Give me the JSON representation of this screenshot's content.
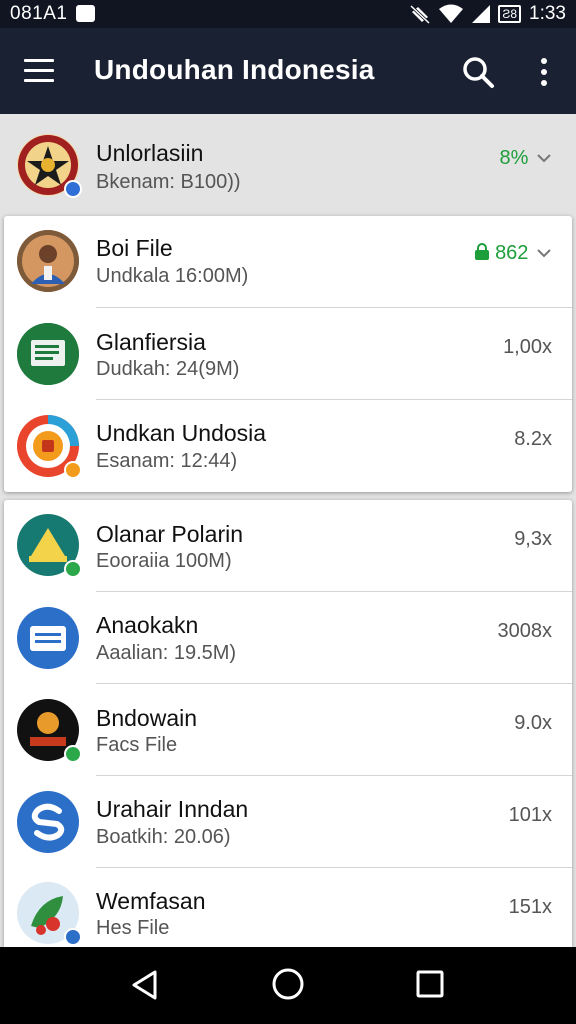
{
  "status_bar": {
    "time_left": "081A1",
    "clock": "1:33",
    "battery_label": "Ƨ8"
  },
  "app_bar": {
    "title": "Undouhan Indonesia"
  },
  "header_row": {
    "name": "Unlorlasiin",
    "subtitle": "Bkenam: B100))",
    "meta": "8%"
  },
  "card_1": [
    {
      "name": "Boi File",
      "subtitle": "Undkala 16:00M)",
      "meta": "862"
    },
    {
      "name": "Glanfiersia",
      "subtitle": "Dudkah: 24(9M)",
      "meta": "1,00x"
    },
    {
      "name": "Undkan Undosia",
      "subtitle": "Esanam: 12:44)",
      "meta": "8.2x"
    }
  ],
  "card_2": [
    {
      "name": "Olanar Polarin",
      "subtitle": "Eooraiia 100M)",
      "meta": "9,3x"
    },
    {
      "name": "Anaokakn",
      "subtitle": "Aaalian: 19.5M)",
      "meta": "3008x"
    },
    {
      "name": "Bndowain",
      "subtitle": "Facs File",
      "meta": "9.0x"
    },
    {
      "name": "Urahair Inndan",
      "subtitle": "Boatkih: 20.06)",
      "meta": "101x"
    },
    {
      "name": "Wemfasan",
      "subtitle": "Hes File",
      "meta": "151x"
    }
  ],
  "colors": {
    "app_bar": "#1a2133",
    "status_bar": "#111522",
    "accent_green": "#1e9e3a",
    "background": "#e3e3e3"
  },
  "icons": {
    "menu": "hamburger-menu-icon",
    "search": "search-icon",
    "more": "more-vert-icon",
    "back": "nav-back-icon",
    "home": "nav-home-icon",
    "recents": "nav-recents-icon"
  }
}
